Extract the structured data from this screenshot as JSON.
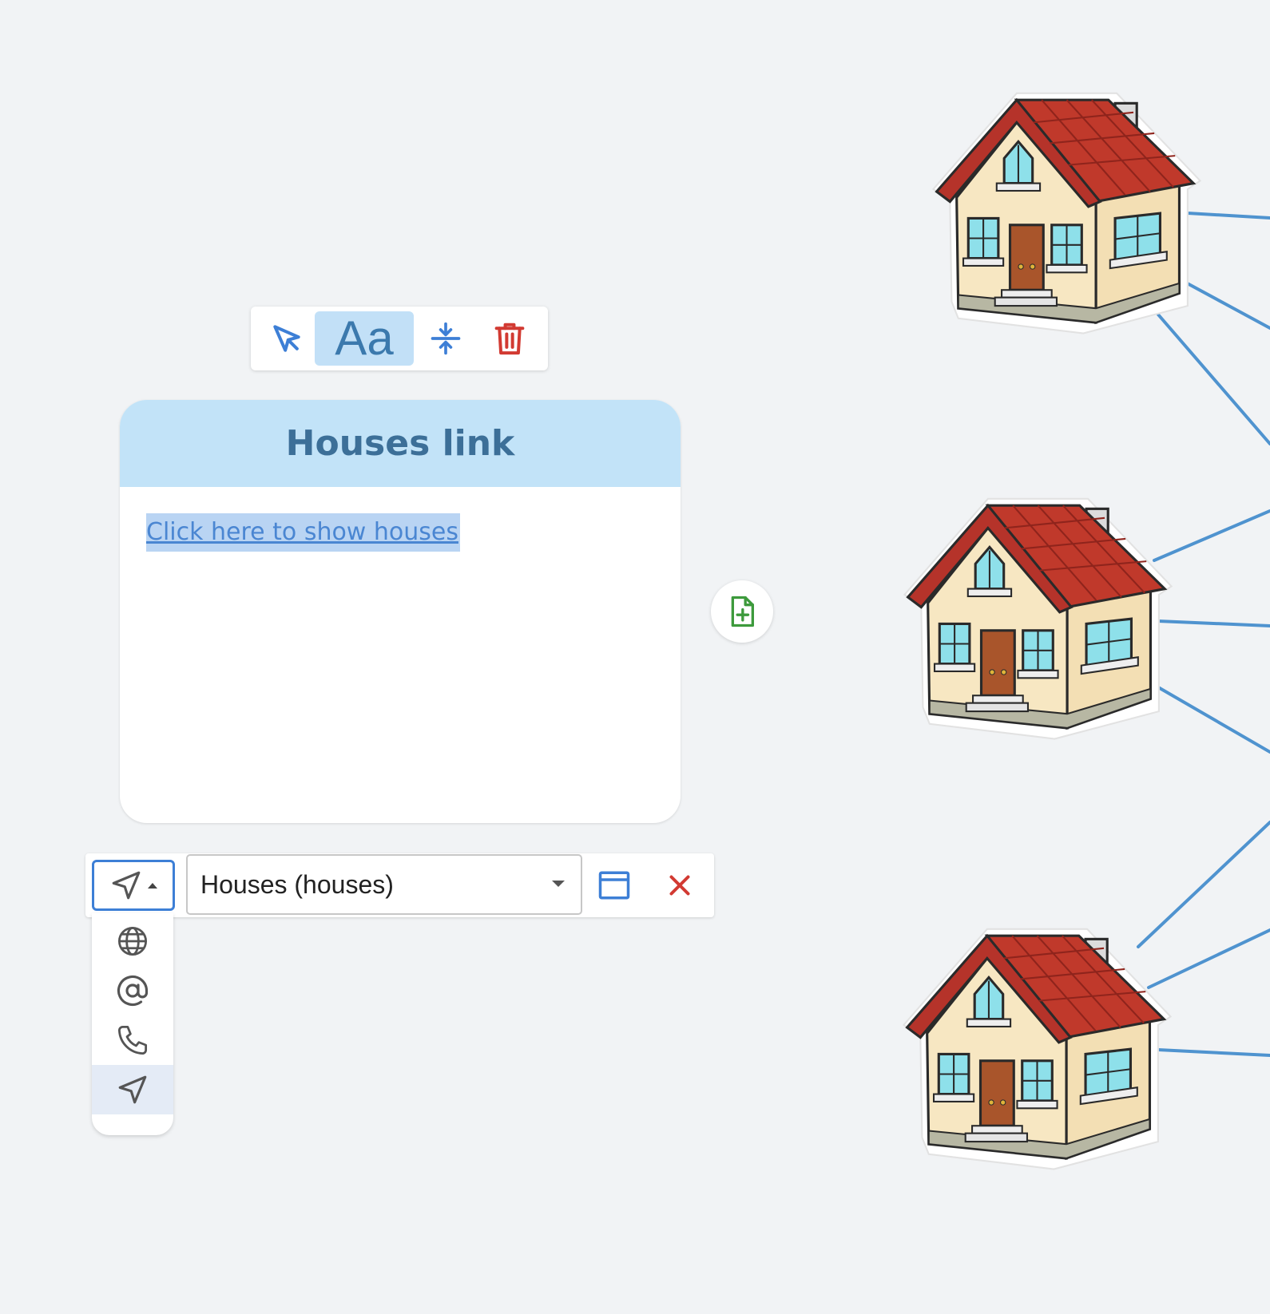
{
  "toolbar": {
    "select_tool": "cursor-arrow",
    "text_tool_label": "Aa",
    "compress_tool": "compress",
    "delete_tool": "trash"
  },
  "card": {
    "title": "Houses link",
    "link_text": "Click here to show houses"
  },
  "link_editor": {
    "type_selected": "navigation",
    "target_value": "Houses (houses)",
    "open_icon": "window",
    "remove_icon": "close"
  },
  "link_type_menu": {
    "items": [
      {
        "icon": "globe"
      },
      {
        "icon": "at-sign"
      },
      {
        "icon": "phone"
      },
      {
        "icon": "navigation",
        "selected": true
      }
    ]
  },
  "colors": {
    "background": "#f1f3f5",
    "accent": "#3d7fd6",
    "header": "#c2e3f8",
    "delete": "#d23a32",
    "add_page": "#3d9a3c",
    "connector": "#4f93cf",
    "roof": "#c0392b"
  }
}
